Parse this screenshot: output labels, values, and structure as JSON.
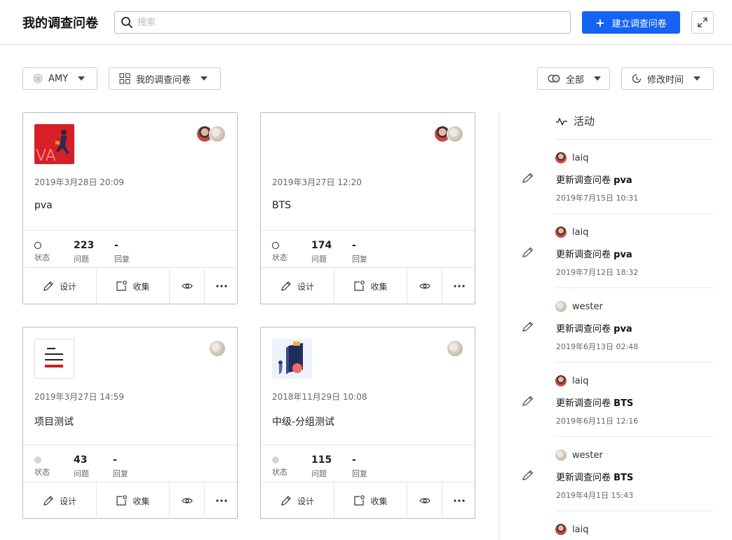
{
  "header": {
    "title": "我的调查问卷",
    "search_placeholder": "搜索",
    "create_label": "建立调查问卷",
    "accent": "#1463f2"
  },
  "filters": {
    "team": "AMY",
    "scope": "我的调查问卷",
    "status": "全部",
    "sort": "修改时间"
  },
  "cards": [
    {
      "date": "2019年3月28日 20:09",
      "title": "pva",
      "status": "open",
      "status_label": "状态",
      "questions": "223",
      "questions_label": "问题",
      "replies": "-",
      "replies_label": "回复",
      "design": "设计",
      "collect": "收集"
    },
    {
      "date": "2019年3月27日 12:20",
      "title": "BTS",
      "status": "open",
      "status_label": "状态",
      "questions": "174",
      "questions_label": "问题",
      "replies": "-",
      "replies_label": "回复",
      "design": "设计",
      "collect": "收集"
    },
    {
      "date": "2019年3月27日 14:59",
      "title": "项目测试",
      "status": "closed",
      "status_label": "状态",
      "questions": "43",
      "questions_label": "问题",
      "replies": "-",
      "replies_label": "回复",
      "design": "设计",
      "collect": "收集"
    },
    {
      "date": "2018年11月29日 10:08",
      "title": "中级-分组测试",
      "status": "closed",
      "status_label": "状态",
      "questions": "115",
      "questions_label": "问题",
      "replies": "-",
      "replies_label": "回复",
      "design": "设计",
      "collect": "收集"
    }
  ],
  "activity": {
    "title": "活动",
    "items": [
      {
        "user": "laiq",
        "action": "更新调查问卷",
        "target": "pva",
        "time": "2019年7月15日 10:31"
      },
      {
        "user": "laiq",
        "action": "更新调查问卷",
        "target": "pva",
        "time": "2019年7月12日 18:32"
      },
      {
        "user": "wester",
        "action": "更新调查问卷",
        "target": "pva",
        "time": "2019年6月13日 02:48"
      },
      {
        "user": "laiq",
        "action": "更新调查问卷",
        "target": "BTS",
        "time": "2019年6月11日 12:16"
      },
      {
        "user": "wester",
        "action": "更新调查问卷",
        "target": "BTS",
        "time": "2019年4月1日 15:43"
      },
      {
        "user": "laiq"
      }
    ]
  }
}
